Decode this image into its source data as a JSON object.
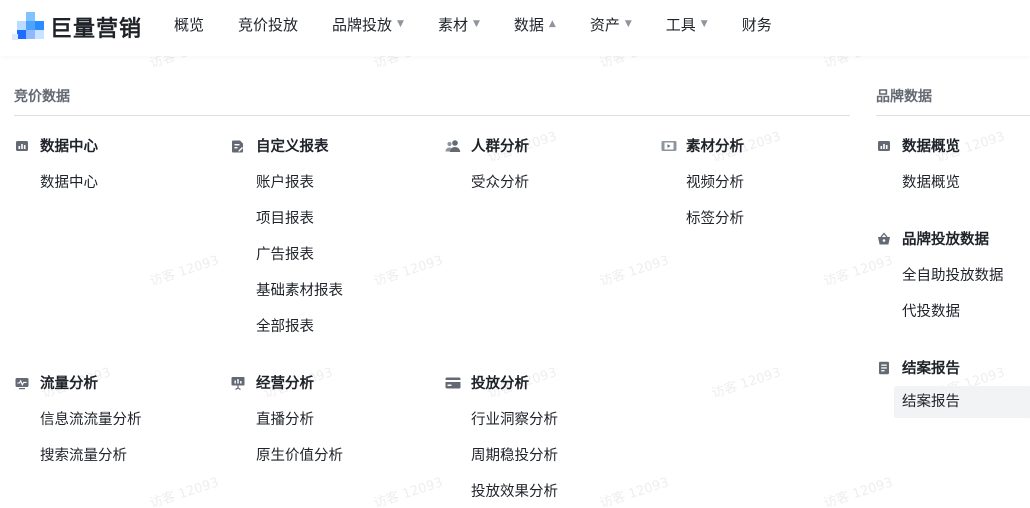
{
  "brand": {
    "name": "巨量营销"
  },
  "nav": {
    "items": [
      {
        "label": "概览",
        "caret": ""
      },
      {
        "label": "竞价投放",
        "caret": ""
      },
      {
        "label": "品牌投放",
        "caret": "▼"
      },
      {
        "label": "素材",
        "caret": "▼"
      },
      {
        "label": "数据",
        "caret": "▲"
      },
      {
        "label": "资产",
        "caret": "▼"
      },
      {
        "label": "工具",
        "caret": "▼"
      },
      {
        "label": "财务",
        "caret": ""
      }
    ]
  },
  "bidding": {
    "title": "竞价数据",
    "groups": {
      "data_center": {
        "title": "数据中心",
        "icon": "bar-chart-icon",
        "items": [
          "数据中心"
        ]
      },
      "custom_report": {
        "title": "自定义报表",
        "icon": "edit-document-icon",
        "items": [
          "账户报表",
          "项目报表",
          "广告报表",
          "基础素材报表",
          "全部报表"
        ]
      },
      "audience": {
        "title": "人群分析",
        "icon": "users-icon",
        "items": [
          "受众分析"
        ]
      },
      "material": {
        "title": "素材分析",
        "icon": "video-film-icon",
        "items": [
          "视频分析",
          "标签分析"
        ]
      },
      "traffic": {
        "title": "流量分析",
        "icon": "pulse-monitor-icon",
        "items": [
          "信息流流量分析",
          "搜索流量分析"
        ]
      },
      "operation": {
        "title": "经营分析",
        "icon": "presentation-icon",
        "items": [
          "直播分析",
          "原生价值分析"
        ]
      },
      "delivery": {
        "title": "投放分析",
        "icon": "card-icon",
        "items": [
          "行业洞察分析",
          "周期稳投分析",
          "投放效果分析"
        ]
      }
    }
  },
  "brand_data": {
    "title": "品牌数据",
    "groups": {
      "overview": {
        "title": "数据概览",
        "icon": "bar-chart-icon",
        "items": [
          "数据概览"
        ]
      },
      "delivery": {
        "title": "品牌投放数据",
        "icon": "basket-icon",
        "items": [
          "全自助投放数据",
          "代投数据"
        ]
      },
      "report": {
        "title": "结案报告",
        "icon": "report-book-icon",
        "items": [
          "结案报告"
        ]
      }
    }
  },
  "watermark": "访客 12093",
  "colors": {
    "accent": "#3370ff",
    "text": "#1f2329",
    "muted": "#646a73",
    "selected_bg": "#f2f3f5"
  }
}
